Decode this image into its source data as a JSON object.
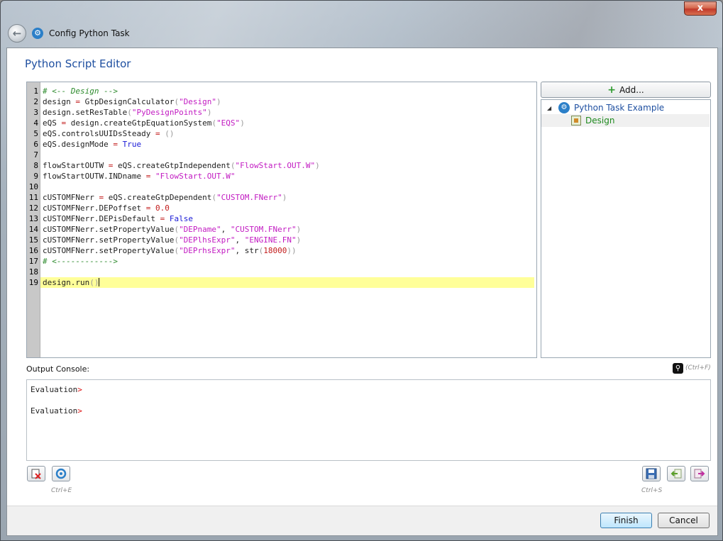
{
  "window": {
    "title": "Config Python Task",
    "close_label": "x"
  },
  "heading": "Python Script Editor",
  "editor": {
    "line_numbers": [
      "1",
      "2",
      "3",
      "4",
      "5",
      "6",
      "7",
      "8",
      "9",
      "10",
      "11",
      "12",
      "13",
      "14",
      "15",
      "16",
      "17",
      "18",
      "19"
    ],
    "lines": [
      "# <-- Design -->",
      "design = GtpDesignCalculator(\"Design\")",
      "design.setResTable(\"PyDesignPoints\")",
      "eQS = design.createGtpEquationSystem(\"EQS\")",
      "eQS.controlsUUIDsSteady = ()",
      "eQS.designMode = True",
      "",
      "flowStartOUTW = eQS.createGtpIndependent(\"FlowStart.OUT.W\")",
      "flowStartOUTW.INDname = \"FlowStart.OUT.W\"",
      "",
      "cUSTOMFNerr = eQS.createGtpDependent(\"CUSTOM.FNerr\")",
      "cUSTOMFNerr.DEPoffset = 0.0",
      "cUSTOMFNerr.DEPisDefault = False",
      "cUSTOMFNerr.setPropertyValue(\"DEPname\", \"CUSTOM.FNerr\")",
      "cUSTOMFNerr.setPropertyValue(\"DEPlhsExpr\", \"ENGINE.FN\")",
      "cUSTOMFNerr.setPropertyValue(\"DEPrhsExpr\", str(18000))",
      "# <------------>",
      "",
      "design.run()"
    ],
    "active_line": 19
  },
  "right_panel": {
    "add_label": "Add...",
    "tree_root": "Python Task Example",
    "tree_child": "Design"
  },
  "console": {
    "label": "Output Console:",
    "find_shortcut": "(Ctrl+F)",
    "lines": [
      "Evaluation",
      "Evaluation"
    ],
    "prompt": ">"
  },
  "toolbar": {
    "clear_shortcut": "Ctrl+E",
    "save_shortcut": "Ctrl+S"
  },
  "footer": {
    "finish_label": "Finish",
    "cancel_label": "Cancel"
  }
}
